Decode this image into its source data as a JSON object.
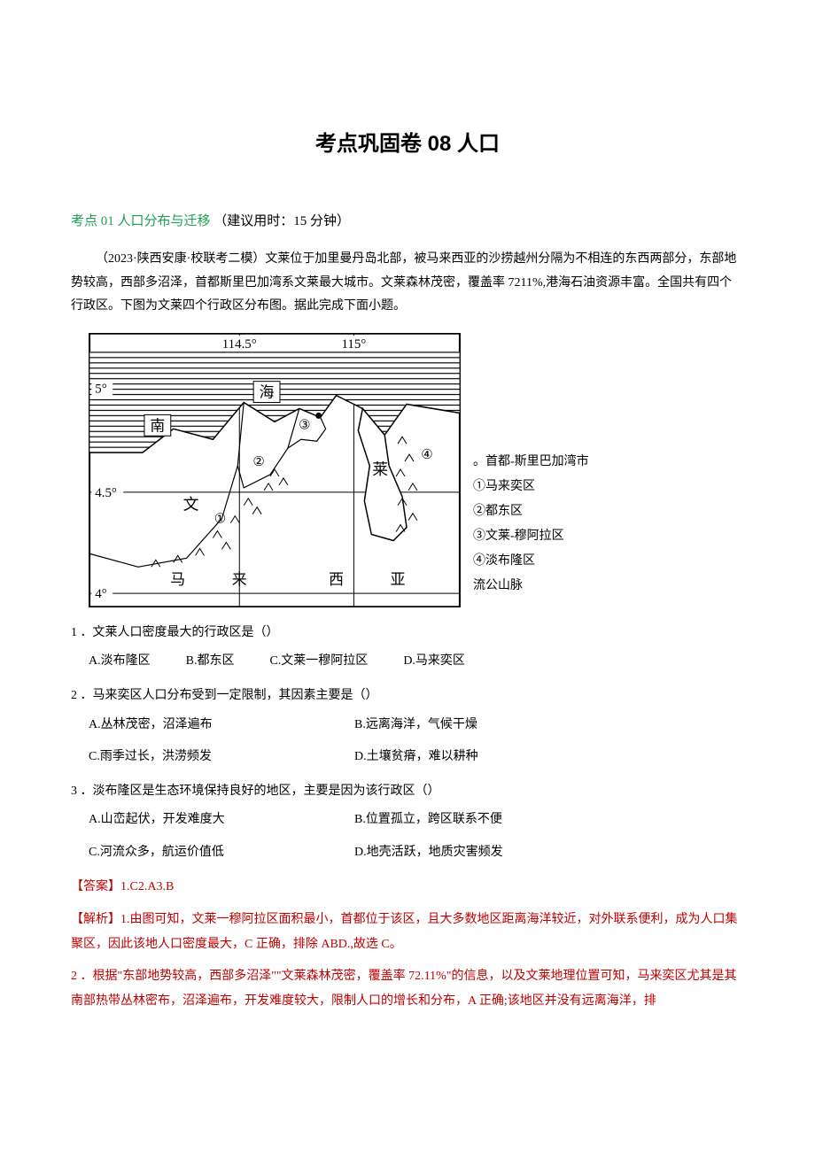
{
  "title": "考点巩固卷 08 人口",
  "section": {
    "topic": "考点 01 人口分布与迁移",
    "time": "（建议用时：15 分钟）"
  },
  "passage": "（2023·陕西安康·校联考二模）文莱位于加里曼丹岛北部，被马来西亚的沙捞越州分隔为不相连的东西两部分，东部地势较高，西部多沼泽，首都斯里巴加湾系文莱最大城市。文莱森林茂密，覆盖率 7211%,港海石油资源丰富。全国共有四个行政区。下图为文莱四个行政区分布图。据此完成下面小题。",
  "map": {
    "lon_left": "114.5°",
    "lon_right": "115°",
    "lat_top": "5°",
    "lat_mid": "4.5°",
    "lat_bot": "4°",
    "sea_nan": "南",
    "sea_hai": "海",
    "country_wen": "文",
    "country_lai": "莱",
    "malay_ma": "马",
    "malay_lai": "来",
    "malay_xi": "西",
    "malay_ya": "亚",
    "m1": "①",
    "m2": "②",
    "m3": "③",
    "m4": "④",
    "capital": "。"
  },
  "legend": {
    "capital": "。首都-斯里巴加湾市",
    "r1": "①马来奕区",
    "r2": "②都东区",
    "r3": "③文莱-穆阿拉区",
    "r4": "④淡布隆区",
    "mountains": "流公山脉"
  },
  "q1": {
    "stem": "1 ．文莱人口密度最大的行政区是（）",
    "a": "A.淡布隆区",
    "b": "B.都东区",
    "c": "C.文莱一穆阿拉区",
    "d": "D.马来奕区"
  },
  "q2": {
    "stem": "2 ．马来奕区人口分布受到一定限制，其因素主要是（）",
    "a": "A.丛林茂密，沼泽遍布",
    "b": "B.远离海洋，气候干燥",
    "c": "C.雨季过长，洪涝频发",
    "d": "D.土壤贫瘠，难以耕种"
  },
  "q3": {
    "stem": "3 ．淡布隆区是生态环境保持良好的地区，主要是因为该行政区（）",
    "a": "A.山峦起伏，开发难度大",
    "b": "B.位置孤立，跨区联系不便",
    "c": "C.河流众多，航运价值低",
    "d": "D.地壳活跃，地质灾害频发"
  },
  "answerKey": "【答案】1.C2.A3.B",
  "explain1": "【解析】1.由图可知，文莱一穆阿拉区面积最小，首都位于该区，且大多数地区距离海洋较近，对外联系便利，成为人口集聚区，因此该地人口密度最大，C 正确，排除 ABD.,故选 C。",
  "explain2": "2 ．根据\"东部地势较高，西部多沼泽\"\"文莱森林茂密，覆盖率 72.11%\"的信息，以及文莱地理位置可知，马来奕区尤其是其南部热带丛林密布，沼泽遍布，开发难度较大，限制人口的增长和分布，A 正确;该地区并没有远离海洋，排"
}
